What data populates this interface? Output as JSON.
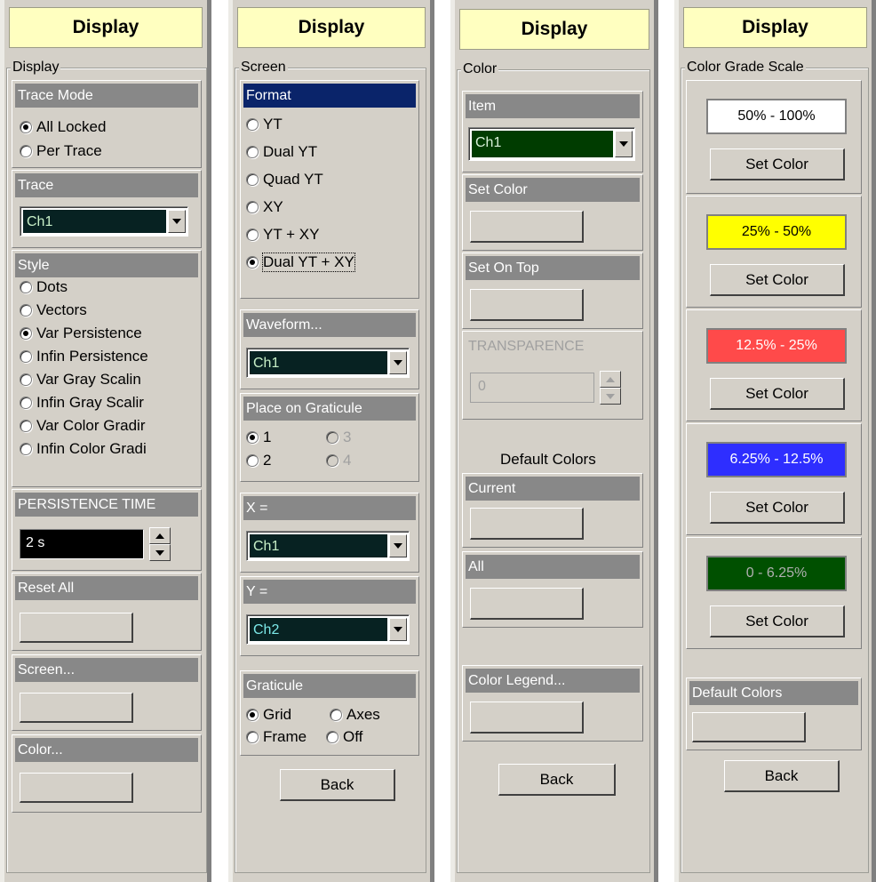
{
  "panel1": {
    "title": "Display",
    "group": "Display",
    "trace_mode": {
      "header": "Trace Mode",
      "options": [
        "All Locked",
        "Per Trace"
      ],
      "selected": "All Locked"
    },
    "trace": {
      "header": "Trace",
      "value": "Ch1"
    },
    "style": {
      "header": "Style",
      "options": [
        "Dots",
        "Vectors",
        "Var Persistence",
        "Infin Persistence",
        "Var Gray Scalin",
        "Infin Gray Scalir",
        "Var Color Gradir",
        "Infin Color Gradi"
      ],
      "selected": "Var Persistence"
    },
    "persistence": {
      "header": "PERSISTENCE TIME",
      "value": "2 s"
    },
    "reset_all": {
      "header": "Reset All"
    },
    "screen": {
      "header": "Screen..."
    },
    "color": {
      "header": "Color..."
    }
  },
  "panel2": {
    "title": "Display",
    "group": "Screen",
    "format": {
      "header": "Format",
      "options": [
        "YT",
        "Dual YT",
        "Quad YT",
        "XY",
        "YT + XY",
        "Dual YT + XY"
      ],
      "selected": "Dual YT + XY"
    },
    "waveform": {
      "header": "Waveform...",
      "value": "Ch1"
    },
    "place": {
      "header": "Place on Graticule",
      "options": [
        "1",
        "2",
        "3",
        "4"
      ],
      "selected": "1",
      "disabled": [
        "3",
        "4"
      ]
    },
    "x": {
      "header": "X =",
      "value": "Ch1"
    },
    "y": {
      "header": "Y =",
      "value": "Ch2"
    },
    "graticule": {
      "header": "Graticule",
      "options": [
        "Grid",
        "Axes",
        "Frame",
        "Off"
      ],
      "selected": "Grid"
    },
    "back": "Back"
  },
  "panel3": {
    "title": "Display",
    "group": "Color",
    "item": {
      "header": "Item",
      "value": "Ch1"
    },
    "set_color": {
      "header": "Set Color"
    },
    "set_on_top": {
      "header": "Set On Top"
    },
    "transparence": {
      "header": "TRANSPARENCE",
      "value": "0"
    },
    "default_colors_label": "Default Colors",
    "current": {
      "header": "Current"
    },
    "all": {
      "header": "All"
    },
    "color_legend": {
      "header": "Color Legend..."
    },
    "back": "Back"
  },
  "panel4": {
    "title": "Display",
    "group": "Color Grade Scale",
    "grades": [
      {
        "label": "50% - 100%",
        "bg": "#ffffff",
        "fg": "#000000",
        "button": "Set Color"
      },
      {
        "label": "25% - 50%",
        "bg": "#ffff00",
        "fg": "#000000",
        "button": "Set Color"
      },
      {
        "label": "12.5% - 25%",
        "bg": "#ff4a4a",
        "fg": "#ffffff",
        "button": "Set Color"
      },
      {
        "label": "6.25% - 12.5%",
        "bg": "#2e2eff",
        "fg": "#ffffff",
        "button": "Set Color"
      },
      {
        "label": "0 - 6.25%",
        "bg": "#005000",
        "fg": "#b0b0b0",
        "button": "Set Color"
      }
    ],
    "default_colors": {
      "header": "Default Colors"
    },
    "back": "Back"
  }
}
